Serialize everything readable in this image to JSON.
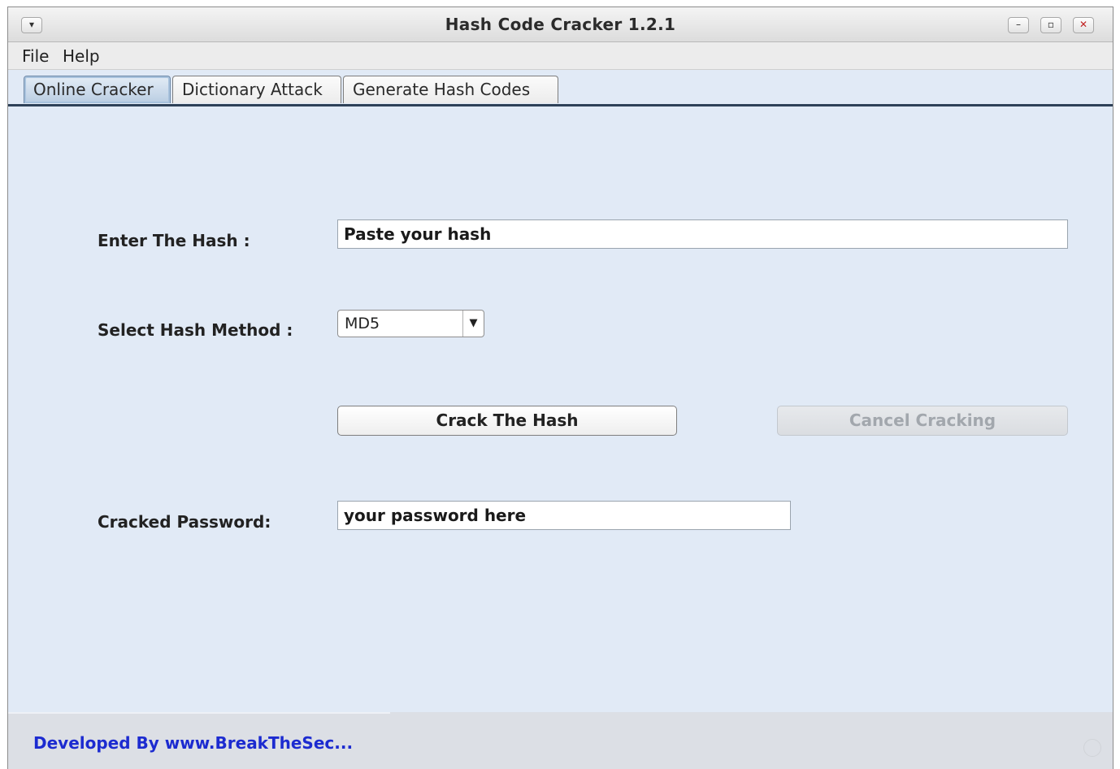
{
  "window": {
    "title": "Hash Code Cracker 1.2.1",
    "controls": {
      "menu_glyph": "▾",
      "minimize_glyph": "–",
      "maximize_glyph": "▫",
      "close_glyph": "✕"
    }
  },
  "menubar": {
    "items": [
      {
        "label": "File"
      },
      {
        "label": "Help"
      }
    ]
  },
  "tabs": [
    {
      "label": "Online Cracker",
      "selected": true
    },
    {
      "label": "Dictionary Attack",
      "selected": false
    },
    {
      "label": "Generate Hash Codes",
      "selected": false
    }
  ],
  "form": {
    "hash_label": "Enter The Hash :",
    "hash_value": "Paste your hash",
    "method_label": "Select Hash Method :",
    "method_selected": "MD5",
    "method_arrow_icon": "▼",
    "crack_button": "Crack The Hash",
    "cancel_button": "Cancel Cracking",
    "password_label": "Cracked Password:",
    "password_value": "your password here"
  },
  "status": {
    "text": "Developed By www.BreakTheSec..."
  },
  "colors": {
    "panel_bg": "#e1eaf6",
    "tab_line": "#2e4158",
    "status_link": "#1c2bd0",
    "disabled_text": "#a2a7ad"
  }
}
